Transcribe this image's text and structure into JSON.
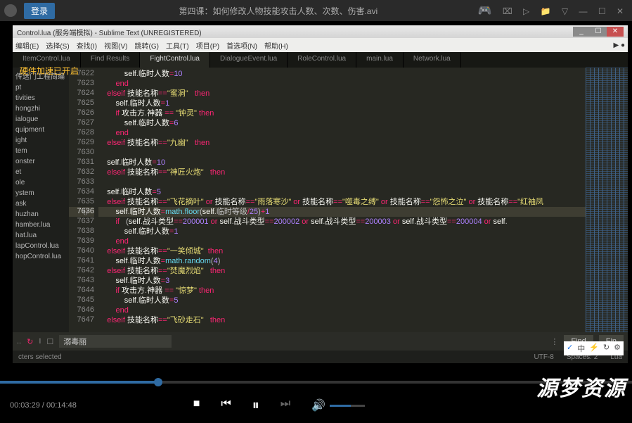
{
  "top": {
    "login": "登录",
    "title": "第四课：如何修改人物技能攻击人数、次数、伤害.avi"
  },
  "st": {
    "title": "Control.lua (服务端模拟) - Sublime Text (UNREGISTERED)",
    "menu": [
      "编辑(E)",
      "选择(S)",
      "查找(I)",
      "视图(V)",
      "跳转(G)",
      "工具(T)",
      "项目(P)",
      "首选项(N)",
      "帮助(H)"
    ],
    "tabs": [
      "ItemControl.lua",
      "Find Results",
      "FightControl.lua",
      "DialogueEvent.lua",
      "RoleControl.lua",
      "main.lua",
      "Network.lua"
    ],
    "active_tab": 2,
    "side": [
      "传送门工程简编",
      "pt",
      "tivities",
      "hongzhi",
      "ialogue",
      "quipment",
      "ight",
      "tem",
      "onster",
      "et",
      "ole",
      "ystem",
      "ask",
      "huzhan",
      "hamber.lua",
      "hat.lua",
      "lapControl.lua",
      "hopControl.lua"
    ],
    "gutter_start": 7622,
    "gutter_count": 26,
    "current_line": 7636,
    "find_value": "溺毒丽",
    "find_btn": "Find",
    "find_btn2": "Fin",
    "status": [
      "cters selected",
      "UTF-8",
      "Spaces: 2",
      "Lua"
    ]
  },
  "hw_overlay": "硬件加速已开启",
  "lang_overlay": [
    "✓",
    "中",
    "⚡",
    "↻",
    "⚙"
  ],
  "player": {
    "cur": "00:03:29",
    "dur": "00:14:48"
  },
  "watermark": "源梦资源",
  "code": [
    "        <span class=id>self</span>.<span class=id>临时人数</span><span class=op>=</span><span class=num>10</span>",
    "    <span class=kw>end</span>",
    "<span class=kw>elseif</span> <span class=id>技能名称</span><span class=op>==</span><span class=str>\"蜜洞\"</span>   <span class=kw>then</span>",
    "    <span class=id>self</span>.<span class=id>临时人数</span><span class=op>=</span><span class=num>1</span>",
    "    <span class=kw>if</span> <span class=id>攻击方</span>.<span class=id>神器</span> <span class=op>==</span> <span class=str>\"钟灵\"</span> <span class=kw>then</span>",
    "        <span class=id>self</span>.<span class=id>临时人数</span><span class=op>=</span><span class=num>6</span>",
    "    <span class=kw>end</span>",
    "<span class=kw>elseif</span> <span class=id>技能名称</span><span class=op>==</span><span class=str>\"九幽\"</span>   <span class=kw>then</span>",
    "",
    "<span class=id>self</span>.<span class=id>临时人数</span><span class=op>=</span><span class=num>10</span>",
    "<span class=kw>elseif</span> <span class=id>技能名称</span><span class=op>==</span><span class=str>\"神匠火炮\"</span>   <span class=kw>then</span>",
    "",
    "<span class=id>self</span>.<span class=id>临时人数</span><span class=op>=</span><span class=num>5</span>",
    "<span class=kw>elseif</span> <span class=id>技能名称</span><span class=op>==</span><span class=str>\"飞花摘叶\"</span> <span class=kw>or</span> <span class=id>技能名称</span><span class=op>==</span><span class=str>\"雨落寒沙\"</span> <span class=kw>or</span> <span class=id>技能名称</span><span class=op>==</span><span class=str>\"噬毒之缚\"</span> <span class=kw>or</span> <span class=id>技能名称</span><span class=op>==</span><span class=str>\"怨怖之泣\"</span> <span class=kw>or</span> <span class=id>技能名称</span><span class=op>==</span><span class=str>\"红袖凤",
    "    <span class=id>self</span>.<span class=id>临时人数</span><span class=op>=</span><span class=fn>math.floor</span>(<span class=id>self</span>.<span style='background:#3e3d32'>临时等级</span><span class=op>/</span><span class=num>25</span>)<span class=op>+</span><span class=num>1</span>",
    "    <span class=kw>if</span>   (<span class=id>self</span>.<span class=id>战斗类型</span><span class=op>==</span><span class=num>200001</span> <span class=kw>or</span> <span class=id>self</span>.<span class=id>战斗类型</span><span class=op>==</span><span class=num>200002</span> <span class=kw>or</span> <span class=id>self</span>.<span class=id>战斗类型</span><span class=op>==</span><span class=num>200003</span> <span class=kw>or</span> <span class=id>self</span>.<span class=id>战斗类型</span><span class=op>==</span><span class=num>200004</span> <span class=kw>or</span> <span class=id>self</span>.",
    "        <span class=id>self</span>.<span class=id>临时人数</span><span class=op>=</span><span class=num>1</span>",
    "    <span class=kw>end</span>",
    "<span class=kw>elseif</span> <span class=id>技能名称</span><span class=op>==</span><span class=str>\"一笑倾城\"</span>  <span class=kw>then</span>",
    "    <span class=id>self</span>.<span class=id>临时人数</span><span class=op>=</span><span class=fn>math.random</span>(<span class=num>4</span>)",
    "<span class=kw>elseif</span> <span class=id>技能名称</span><span class=op>==</span><span class=str>\"焚魔烈焰\"</span>   <span class=kw>then</span>",
    "    <span class=id>self</span>.<span class=id>临时人数</span><span class=op>=</span><span class=num>3</span>",
    "    <span class=kw>if</span> <span class=id>攻击方</span>.<span class=id>神器</span> <span class=op>==</span> <span class=str>\"惊梦\"</span> <span class=kw>then</span>",
    "        <span class=id>self</span>.<span class=id>临时人数</span><span class=op>=</span><span class=num>5</span>",
    "    <span class=kw>end</span>",
    "<span class=kw>elseif</span> <span class=id>技能名称</span><span class=op>==</span><span class=str>\"飞砂走石\"</span>   <span class=kw>then</span>"
  ]
}
